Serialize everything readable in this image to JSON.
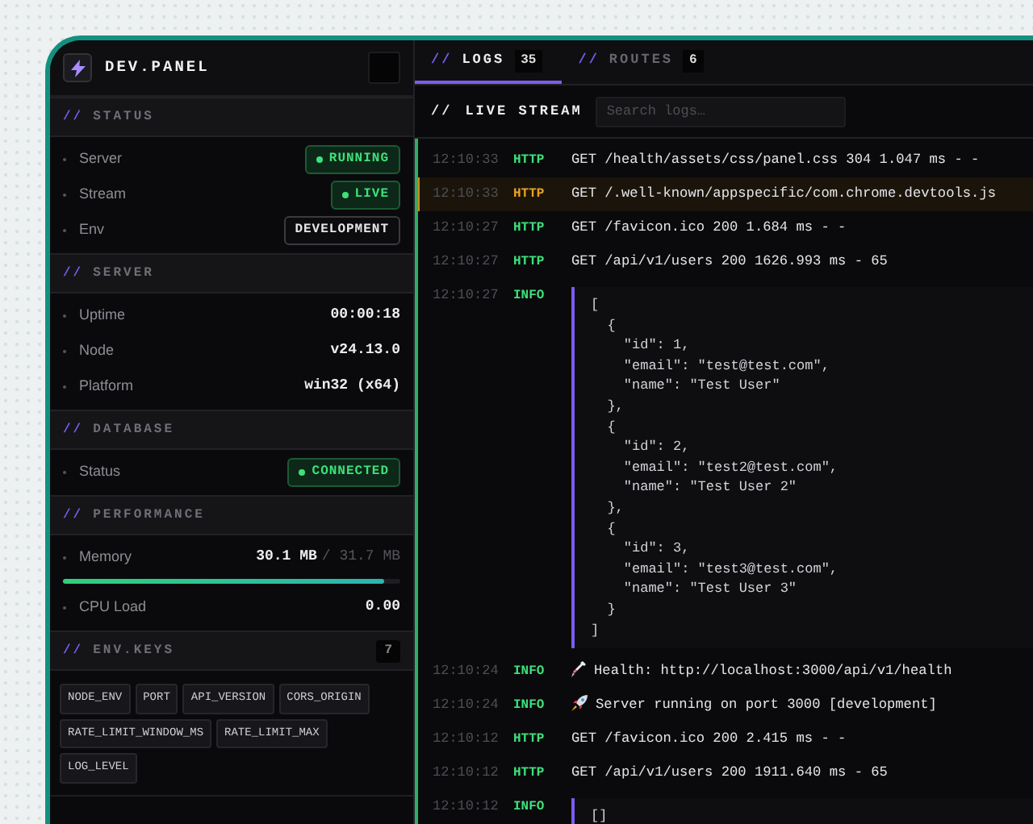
{
  "brand": {
    "title": "DEV.PANEL"
  },
  "sections": [
    {
      "marker": "//",
      "title": "STATUS",
      "rows": [
        {
          "label": "Server",
          "kind": "badge",
          "value": "RUNNING",
          "dot": true
        },
        {
          "label": "Stream",
          "kind": "badge",
          "value": "LIVE",
          "dot": true
        },
        {
          "label": "Env",
          "kind": "badge",
          "value": "DEVELOPMENT",
          "dot": false
        }
      ]
    },
    {
      "marker": "//",
      "title": "SERVER",
      "rows": [
        {
          "label": "Uptime",
          "kind": "text",
          "value": "00:00:18"
        },
        {
          "label": "Node",
          "kind": "text",
          "value": "v24.13.0"
        },
        {
          "label": "Platform",
          "kind": "text",
          "value": "win32 (x64)"
        }
      ]
    },
    {
      "marker": "//",
      "title": "DATABASE",
      "rows": [
        {
          "label": "Status",
          "kind": "badge",
          "value": "CONNECTED",
          "dot": true
        }
      ]
    },
    {
      "marker": "//",
      "title": "PERFORMANCE",
      "rows": [
        {
          "label": "Memory",
          "kind": "meter",
          "value": "30.1 MB",
          "limit": "/ 31.7 MB",
          "level": 0.95
        },
        {
          "label": "CPU Load",
          "kind": "text",
          "value": "0.00"
        }
      ]
    },
    {
      "marker": "//",
      "title": "ENV.KEYS",
      "count": "7",
      "chips": [
        "NODE_ENV",
        "PORT",
        "API_VERSION",
        "CORS_ORIGIN",
        "RATE_LIMIT_WINDOW_MS",
        "RATE_LIMIT_MAX",
        "LOG_LEVEL"
      ]
    }
  ],
  "tabs": [
    {
      "marker": "//",
      "label": "LOGS",
      "count": "35",
      "selected": true
    },
    {
      "marker": "//",
      "label": "ROUTES",
      "count": "6",
      "selected": false
    }
  ],
  "toolbar": {
    "marker": "//",
    "title": "LIVE STREAM",
    "search": {
      "placeholder": "Search logs…"
    }
  },
  "logs": [
    {
      "time": "12:10:33",
      "level": "HTTP",
      "kind": "text",
      "warning": false,
      "message": "GET /health/assets/css/panel.css 304 1.047 ms - -"
    },
    {
      "time": "12:10:33",
      "level": "HTTP",
      "kind": "text",
      "warning": true,
      "message": "GET /.well-known/appspecific/com.chrome.devtools.js"
    },
    {
      "time": "12:10:27",
      "level": "HTTP",
      "kind": "text",
      "warning": false,
      "message": "GET /favicon.ico 200 1.684 ms - -"
    },
    {
      "time": "12:10:27",
      "level": "HTTP",
      "kind": "text",
      "warning": false,
      "message": "GET /api/v1/users 200 1626.993 ms - 65"
    },
    {
      "time": "12:10:27",
      "level": "INFO",
      "kind": "json",
      "warning": false,
      "message": "[\n  {\n    \"id\": 1,\n    \"email\": \"test@test.com\",\n    \"name\": \"Test User\"\n  },\n  {\n    \"id\": 2,\n    \"email\": \"test2@test.com\",\n    \"name\": \"Test User 2\"\n  },\n  {\n    \"id\": 3,\n    \"email\": \"test3@test.com\",\n    \"name\": \"Test User 3\"\n  }\n]"
    },
    {
      "time": "12:10:24",
      "level": "INFO",
      "kind": "emoji",
      "warning": false,
      "message": "Health: http://localhost:3000/api/v1/health"
    },
    {
      "time": "12:10:24",
      "level": "INFO",
      "kind": "emoji",
      "warning": false,
      "message": "Server running on port 3000 [development]"
    },
    {
      "time": "12:10:12",
      "level": "HTTP",
      "kind": "text",
      "warning": false,
      "message": "GET /favicon.ico 200 2.415 ms - -"
    },
    {
      "time": "12:10:12",
      "level": "HTTP",
      "kind": "text",
      "warning": false,
      "message": "GET /api/v1/users 200 1911.640 ms - 65"
    },
    {
      "time": "12:10:12",
      "level": "INFO",
      "kind": "json",
      "warning": false,
      "message": "[]"
    }
  ]
}
